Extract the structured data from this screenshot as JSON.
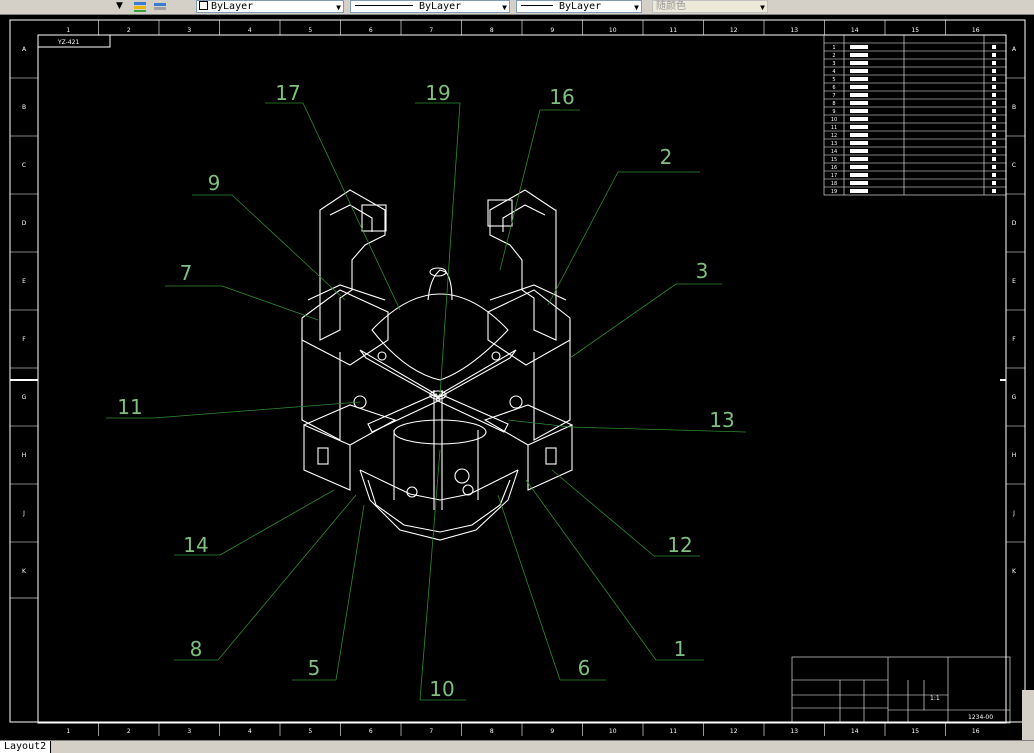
{
  "toolbar": {
    "layer_swatch_label": "ByLayer",
    "linetype_label": "ByLayer",
    "lineweight_label": "ByLayer",
    "plotstyle_label": "随颜色"
  },
  "layout_tab": "Layout2",
  "drawing": {
    "title_tag": "YZ-421",
    "column_labels": [
      "1",
      "2",
      "3",
      "4",
      "5",
      "6",
      "7",
      "8",
      "9",
      "10",
      "11",
      "12",
      "13",
      "14",
      "15",
      "16"
    ],
    "row_labels": [
      "A",
      "B",
      "C",
      "D",
      "E",
      "F",
      "G",
      "H",
      "J",
      "K"
    ],
    "callouts": [
      "1",
      "2",
      "3",
      "5",
      "6",
      "7",
      "8",
      "9",
      "10",
      "11",
      "12",
      "13",
      "14",
      "16",
      "17",
      "19"
    ],
    "bom_rows": [
      "1",
      "2",
      "3",
      "4",
      "5",
      "6",
      "7",
      "8",
      "9",
      "10",
      "11",
      "12",
      "13",
      "14",
      "15",
      "16",
      "17",
      "18",
      "19"
    ],
    "title_block": {
      "drawing_no": "1234-00",
      "scale": "1:1"
    }
  },
  "colors": {
    "line": "#ffffff",
    "leader": "#2e8b2e",
    "callout_text": "#7fbf7f",
    "background": "#000000"
  }
}
